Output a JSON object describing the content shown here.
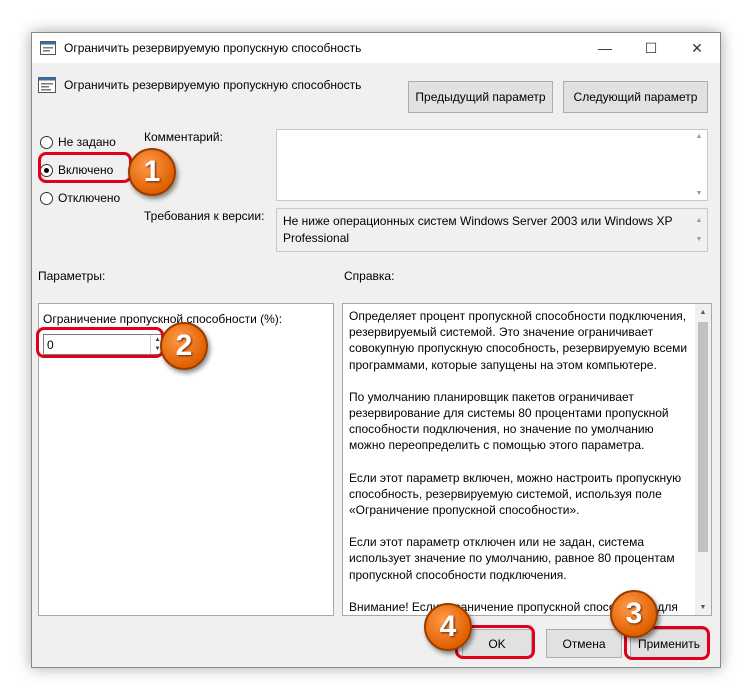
{
  "window": {
    "title": "Ограничить резервируемую пропускную способность",
    "controls": {
      "minimize": "—",
      "maximize": "☐",
      "close": "✕"
    }
  },
  "header": {
    "policy_name": "Ограничить резервируемую пропускную способность",
    "prev_button": "Предыдущий параметр",
    "next_button": "Следующий параметр"
  },
  "state": {
    "options": [
      {
        "label": "Не задано",
        "selected": false
      },
      {
        "label": "Включено",
        "selected": true
      },
      {
        "label": "Отключено",
        "selected": false
      }
    ]
  },
  "comment": {
    "label": "Комментарий:",
    "value": ""
  },
  "version": {
    "label": "Требования к версии:",
    "value": "Не ниже операционных систем Windows Server 2003 или Windows XP Professional"
  },
  "params": {
    "label": "Параметры:",
    "field_label": "Ограничение пропускной способности (%):",
    "field_value": "0"
  },
  "help": {
    "label": "Справка:",
    "paragraphs": [
      "Определяет процент пропускной способности подключения, резервируемый системой. Это значение ограничивает совокупную пропускную способность, резервируемую всеми программами, которые запущены на этом компьютере.",
      "По умолчанию планировщик пакетов ограничивает резервирование для системы 80 процентами пропускной способности подключения, но значение по умолчанию можно переопределить с помощью этого параметра.",
      "Если этот параметр включен, можно настроить пропускную способность, резервируемую системой, используя поле «Ограничение пропускной способности».",
      "Если этот параметр отключен или не задан, система использует значение по умолчанию, равное 80 процентам пропускной способности подключения.",
      "Внимание! Если ограничение пропускной способности для"
    ]
  },
  "footer": {
    "ok": "OK",
    "cancel": "Отмена",
    "apply": "Применить"
  },
  "annotations": {
    "step1": "1",
    "step2": "2",
    "step3": "3",
    "step4": "4"
  },
  "colors": {
    "highlight": "#e0001b",
    "badge": "#e06000"
  }
}
